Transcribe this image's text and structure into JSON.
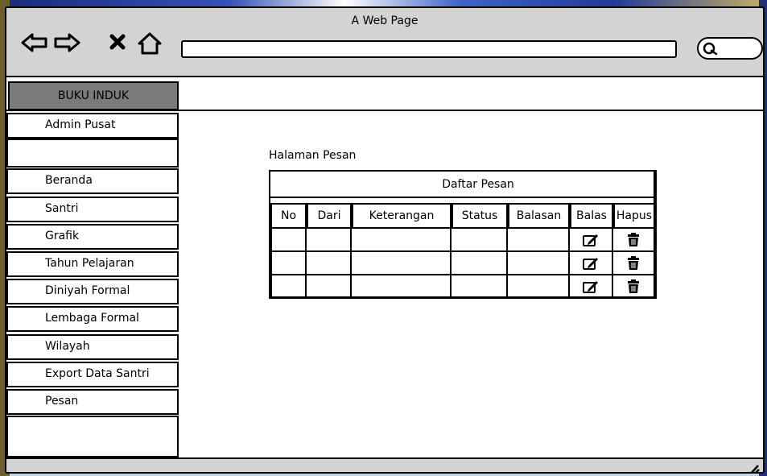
{
  "window": {
    "title": "A Web Page"
  },
  "browser": {
    "back_icon": "arrow-left-outline",
    "forward_icon": "arrow-right-outline",
    "close_icon": "x",
    "home_icon": "house-outline",
    "search_icon": "magnifier"
  },
  "sidebar": {
    "brand": "BUKU INDUK",
    "header_item": "Admin Pusat",
    "items": [
      {
        "label": "Beranda"
      },
      {
        "label": "Santri"
      },
      {
        "label": "Grafik"
      },
      {
        "label": "Tahun Pelajaran"
      },
      {
        "label": "Diniyah Formal"
      },
      {
        "label": "Lembaga Formal"
      },
      {
        "label": "Wilayah"
      },
      {
        "label": "Export Data Santri"
      },
      {
        "label": "Pesan"
      }
    ]
  },
  "main": {
    "page_label": "Halaman Pesan",
    "table": {
      "title": "Daftar Pesan",
      "columns": [
        "No",
        "Dari",
        "Keterangan",
        "Status",
        "Balasan",
        "Balas",
        "Hapus"
      ],
      "rows": [
        {
          "no": "",
          "dari": "",
          "keterangan": "",
          "status": "",
          "balasan": "",
          "reply_icon": "edit-icon",
          "delete_icon": "trash-icon"
        },
        {
          "no": "",
          "dari": "",
          "keterangan": "",
          "status": "",
          "balasan": "",
          "reply_icon": "edit-icon",
          "delete_icon": "trash-icon"
        },
        {
          "no": "",
          "dari": "",
          "keterangan": "",
          "status": "",
          "balasan": "",
          "reply_icon": "edit-icon",
          "delete_icon": "trash-icon"
        }
      ]
    }
  }
}
